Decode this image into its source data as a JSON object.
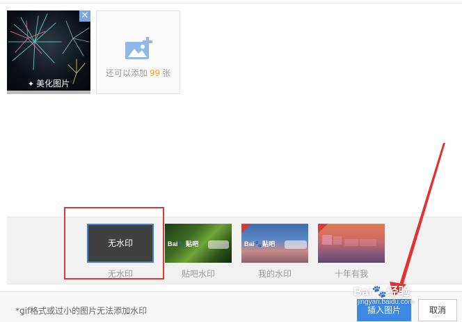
{
  "upload": {
    "image_action_label": "美化图片",
    "close_icon": "close-icon",
    "wand_icon": "magic-wand-icon"
  },
  "add_more": {
    "prefix": "还可以添加",
    "count": "99",
    "suffix": "张",
    "icon": "add-image-icon"
  },
  "watermarks": {
    "none": {
      "thumb_text": "无水印",
      "label": "无水印"
    },
    "tieba": {
      "logo_text": "Bai🐾贴吧",
      "label": "贴吧水印"
    },
    "mine": {
      "logo_text": "Bai🐾贴吧",
      "label": "我的水印"
    },
    "year": {
      "label": "十年有我"
    }
  },
  "footer": {
    "tip": "*gif格式或过小的图片无法添加水印",
    "insert_label": "插入图片",
    "cancel_label": "取消"
  },
  "watermark_overlay": {
    "brand": "Bai🐾经验",
    "url": "jingyan.baidu.com"
  },
  "colors": {
    "accent": "#3d88e5",
    "annotation_red": "#d9383a",
    "count_orange": "#f0a020"
  }
}
